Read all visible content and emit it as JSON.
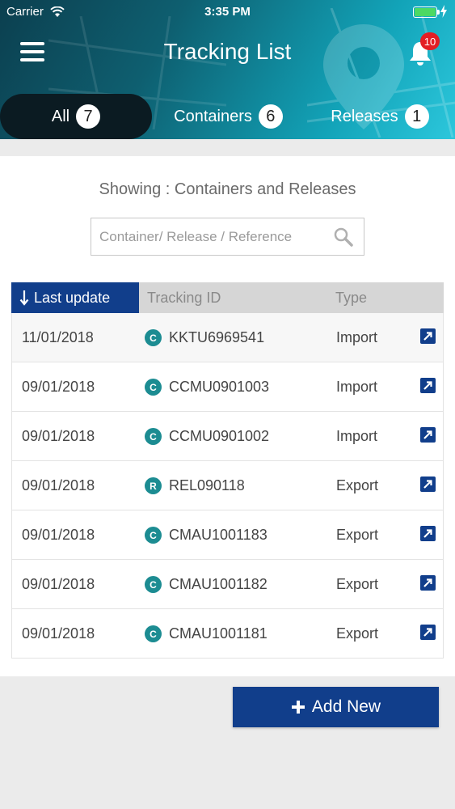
{
  "status_bar": {
    "carrier": "Carrier",
    "time": "3:35 PM"
  },
  "header": {
    "title": "Tracking List",
    "notification_count": "10"
  },
  "tabs": [
    {
      "label": "All",
      "count": "7",
      "active": true
    },
    {
      "label": "Containers",
      "count": "6",
      "active": false
    },
    {
      "label": "Releases",
      "count": "1",
      "active": false
    }
  ],
  "filter": {
    "showing_text": "Showing : Containers and Releases"
  },
  "search": {
    "placeholder": "Container/ Release / Reference"
  },
  "table": {
    "columns": {
      "last_update": "Last update",
      "tracking_id": "Tracking ID",
      "type": "Type"
    },
    "rows": [
      {
        "date": "11/01/2018",
        "kind": "C",
        "id": "KKTU6969541",
        "type": "Import"
      },
      {
        "date": "09/01/2018",
        "kind": "C",
        "id": "CCMU0901003",
        "type": "Import"
      },
      {
        "date": "09/01/2018",
        "kind": "C",
        "id": "CCMU0901002",
        "type": "Import"
      },
      {
        "date": "09/01/2018",
        "kind": "R",
        "id": "REL090118",
        "type": "Export"
      },
      {
        "date": "09/01/2018",
        "kind": "C",
        "id": "CMAU1001183",
        "type": "Export"
      },
      {
        "date": "09/01/2018",
        "kind": "C",
        "id": "CMAU1001182",
        "type": "Export"
      },
      {
        "date": "09/01/2018",
        "kind": "C",
        "id": "CMAU1001181",
        "type": "Export"
      }
    ]
  },
  "actions": {
    "add_new": "Add New"
  },
  "colors": {
    "primary": "#113e8b",
    "badge": "#e31e24",
    "kind_icon": "#1c8c92",
    "battery": "#4cd964"
  }
}
